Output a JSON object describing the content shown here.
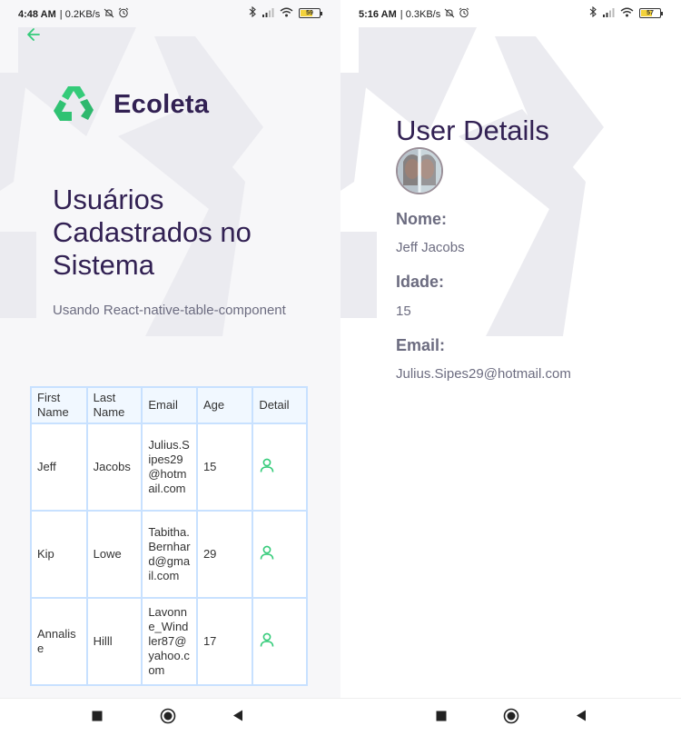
{
  "status_left": {
    "time": "4:48 AM",
    "speed": "| 0.2KB/s",
    "battery": "59"
  },
  "status_right": {
    "time": "5:16 AM",
    "speed": "| 0.3KB/s",
    "battery": "57"
  },
  "app": {
    "name": "Ecoleta",
    "accent_color": "#34cb79",
    "title_color": "#322153"
  },
  "list_screen": {
    "title": "Usuários Cadastrados no Sistema",
    "subtitle": "Usando React-native-table-component",
    "table": {
      "headers": [
        "First Name",
        "Last Name",
        "Email",
        "Age",
        "Detail"
      ],
      "rows": [
        {
          "first": "Jeff",
          "last": "Jacobs",
          "email": "Julius.Sipes29@hotmail.com",
          "age": "15"
        },
        {
          "first": "Kip",
          "last": "Lowe",
          "email": "Tabitha.Bernhard@gmail.com",
          "age": "29"
        },
        {
          "first": "Annalise",
          "last": "Hilll",
          "email": "Lavonne_Windler87@yahoo.com",
          "age": "17"
        }
      ]
    }
  },
  "details_screen": {
    "title": "User Details",
    "fields": [
      {
        "label": "Nome:",
        "value": "Jeff Jacobs"
      },
      {
        "label": "Idade:",
        "value": "15"
      },
      {
        "label": "Email:",
        "value": "Julius.Sipes29@hotmail.com"
      }
    ]
  }
}
